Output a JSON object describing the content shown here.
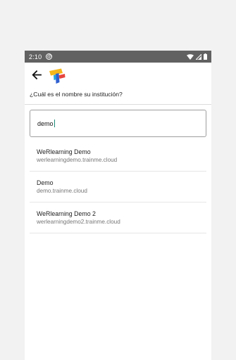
{
  "status_bar": {
    "time": "2:10",
    "icons": [
      "notification-icon",
      "wifi-icon",
      "signal-icon",
      "battery-icon"
    ]
  },
  "header": {
    "back_icon": "arrow-left-icon",
    "logo": "app-logo",
    "question": "¿Cuál es el nombre su institución?"
  },
  "search": {
    "value": "demo"
  },
  "results": [
    {
      "name": "WeRlearning Demo",
      "domain": "werlearningdemo.trainme.cloud"
    },
    {
      "name": "Demo",
      "domain": "demo.trainme.cloud"
    },
    {
      "name": "WeRlearning Demo 2",
      "domain": "werlearningdemo2.trainme.cloud"
    }
  ],
  "colors": {
    "status_bar": "#616161",
    "background": "#f2f2f2",
    "caret": "#1a8c7a"
  }
}
